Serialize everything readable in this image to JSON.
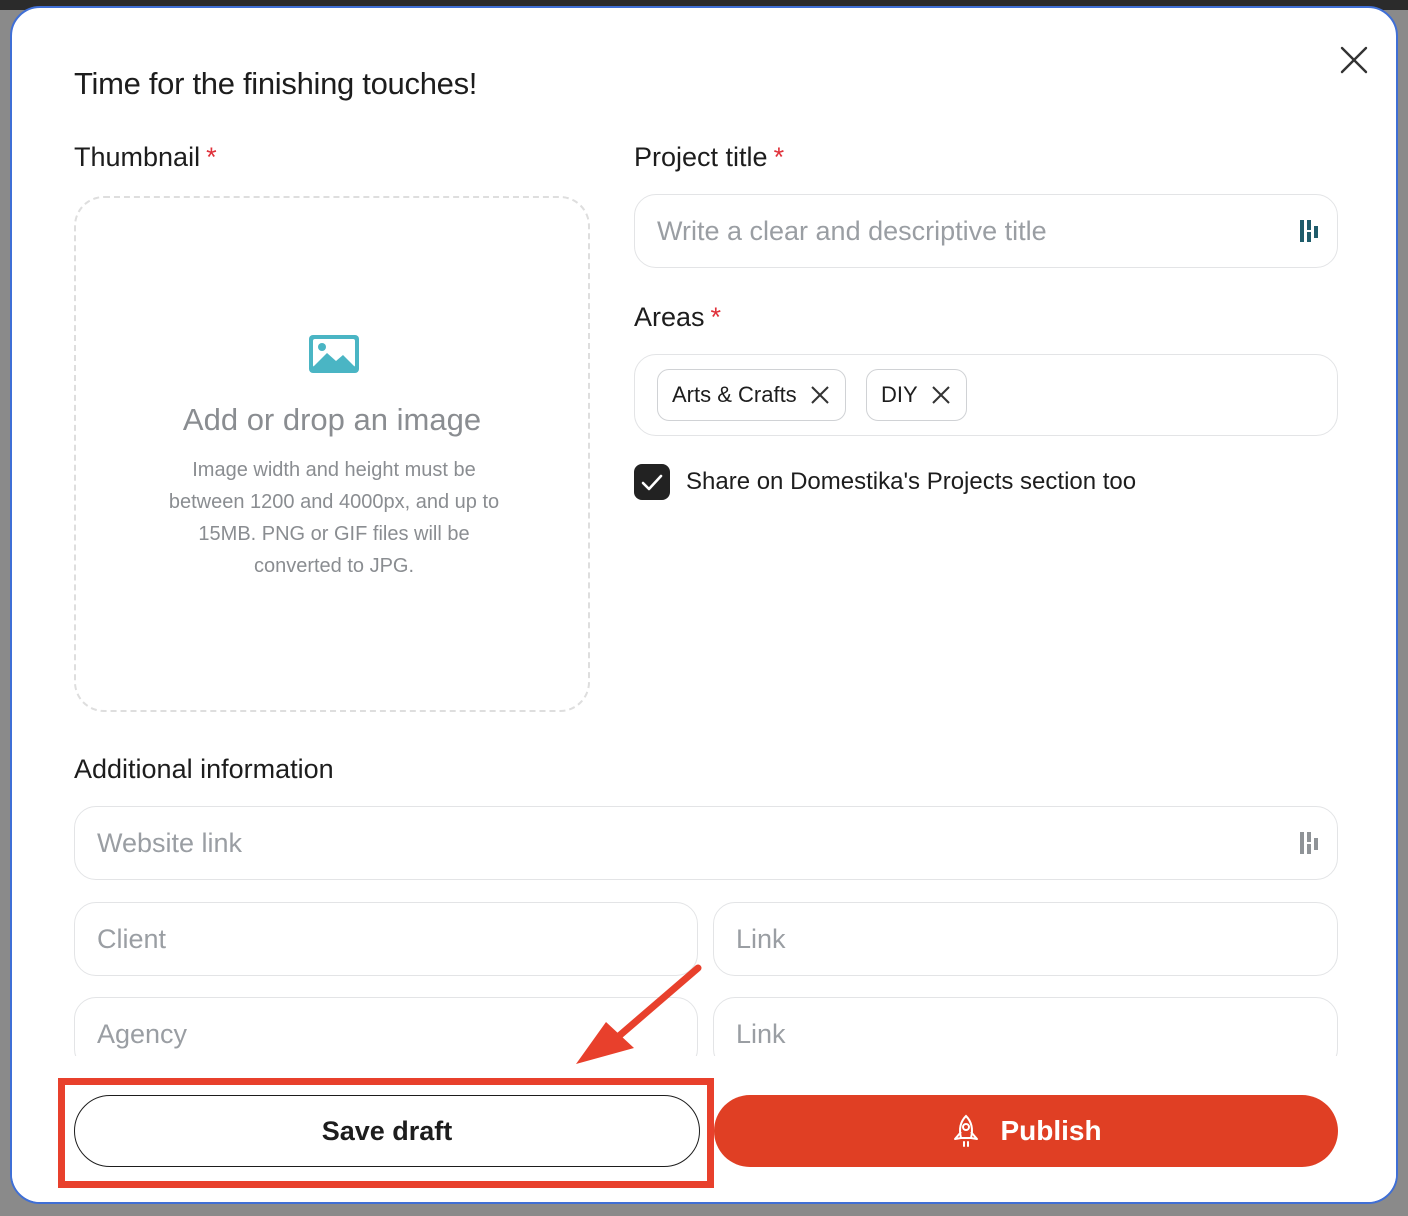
{
  "modal": {
    "title": "Time for the finishing touches!",
    "close_icon": "close-icon"
  },
  "thumbnail": {
    "label": "Thumbnail",
    "required_mark": "*",
    "icon": "image-icon",
    "drop_title": "Add or drop an image",
    "drop_text": "Image width and height must be between 1200 and 4000px, and up to 15MB. PNG or GIF files will be converted to JPG."
  },
  "project_title": {
    "label": "Project title",
    "required_mark": "*",
    "placeholder": "Write a clear and descriptive title",
    "value": ""
  },
  "areas": {
    "label": "Areas",
    "required_mark": "*",
    "tags": [
      "Arts & Crafts",
      "DIY"
    ]
  },
  "share": {
    "checked": true,
    "label": "Share on Domestika's Projects section too"
  },
  "additional": {
    "label": "Additional information",
    "website_placeholder": "Website link",
    "client_placeholder": "Client",
    "client_link_placeholder": "Link",
    "agency_placeholder": "Agency",
    "agency_link_placeholder": "Link"
  },
  "footer": {
    "save_label": "Save draft",
    "publish_label": "Publish",
    "publish_icon": "rocket-icon"
  },
  "colors": {
    "accent": "#e03f24",
    "required": "#e0313a",
    "annotation": "#e8402c",
    "icon_teal": "#4ab5c4"
  }
}
